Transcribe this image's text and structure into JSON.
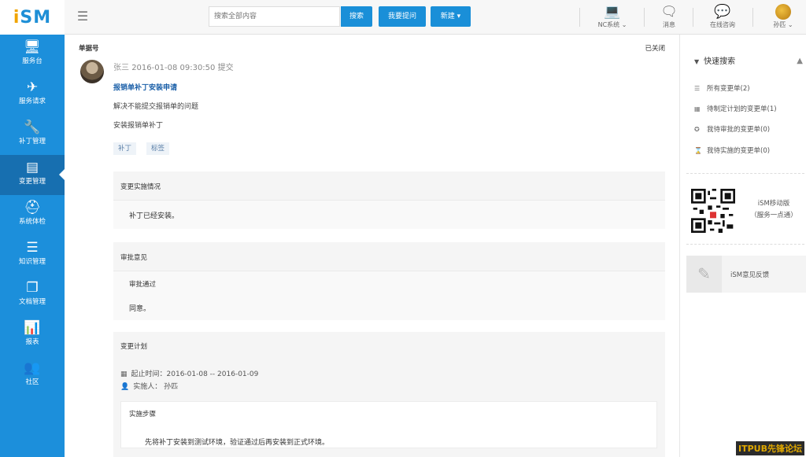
{
  "logo": {
    "i": "i",
    "rest": "SM"
  },
  "header": {
    "search_placeholder": "搜索全部内容",
    "search_btn": "搜索",
    "ask_btn": "我要提问",
    "new_btn": "新建",
    "nc_label": "NC系统",
    "msg_label": "消息",
    "online_label": "在线咨询",
    "user_label": "孙匹"
  },
  "sidebar": {
    "items": [
      {
        "label": "服务台",
        "icon": "monitor-icon"
      },
      {
        "label": "服务请求",
        "icon": "paper-plane-icon"
      },
      {
        "label": "补丁管理",
        "icon": "wrench-icon"
      },
      {
        "label": "变更管理",
        "icon": "server-icon"
      },
      {
        "label": "系统体检",
        "icon": "medical-kit-icon"
      },
      {
        "label": "知识管理",
        "icon": "list-icon"
      },
      {
        "label": "文档管理",
        "icon": "document-icon"
      },
      {
        "label": "报表",
        "icon": "bar-chart-icon"
      },
      {
        "label": "社区",
        "icon": "users-icon"
      }
    ]
  },
  "main": {
    "doc_no_label": "单据号",
    "status": "已关闭",
    "submitter": "张三",
    "submit_time": "2016-01-08 09:30:50 提交",
    "title": "报销单补丁安装申请",
    "desc1": "解决不能提交报销单的问题",
    "desc2": "安装报销单补丁",
    "tags": [
      "补丁",
      "标签"
    ],
    "impl_head": "变更实施情况",
    "impl_text": "补丁已经安装。",
    "approval_head": "审批意见",
    "approval_result": "审批通过",
    "approval_text": "同意。",
    "plan_head": "变更计划",
    "plan_time": "起止时间：2016-01-08 -- 2016-01-09",
    "plan_person_label": "实施人：",
    "plan_person": "孙匹",
    "steps_head": "实施步骤",
    "steps_text": "先将补丁安装到测试环境，验证通过后再安装到正式环境。"
  },
  "rside": {
    "quick_search": "快速搜索",
    "items": [
      "所有变更单(2)",
      "待制定计划的变更单(1)",
      "我待审批的变更单(0)",
      "我待实施的变更单(0)"
    ],
    "mobile_line1": "iSM移动版",
    "mobile_line2": "（服务一点通）",
    "feedback": "iSM意见反馈"
  },
  "watermark": "ITPUB先锋论坛"
}
